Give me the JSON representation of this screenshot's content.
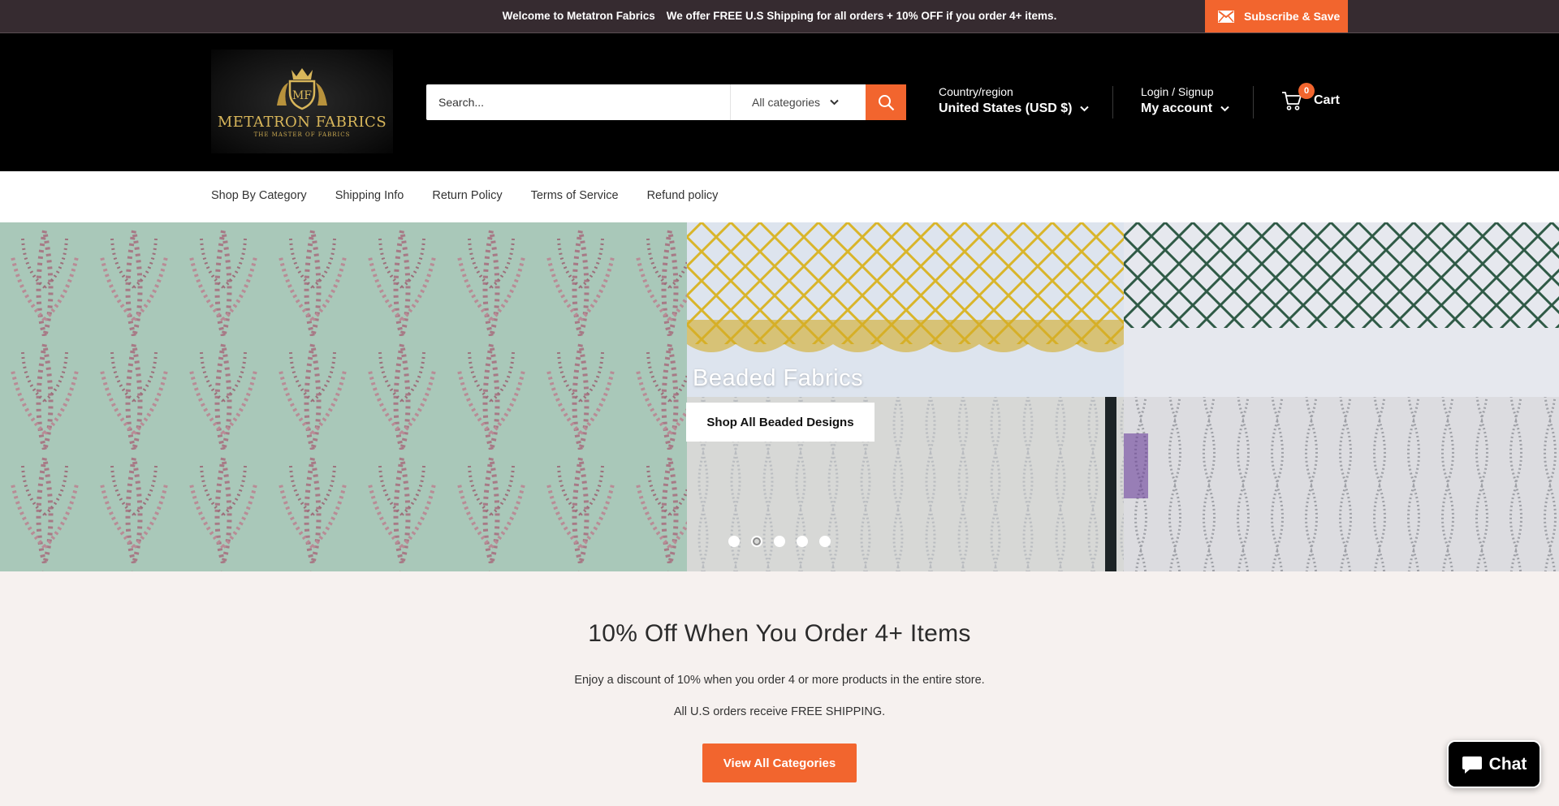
{
  "announcement": {
    "welcome": "Welcome to Metatron Fabrics",
    "offer": "We offer FREE U.S Shipping for all orders + 10% OFF if you order 4+ items.",
    "subscribe_label": "Subscribe & Save"
  },
  "header": {
    "logo_name": "METATRON FABRICS",
    "logo_tagline": "THE MASTER OF FABRICS",
    "search_placeholder": "Search...",
    "category_select": "All categories",
    "country_label": "Country/region",
    "country_value": "United States (USD $)",
    "account_label": "Login / Signup",
    "account_value": "My account",
    "cart_label": "Cart",
    "cart_count": "0"
  },
  "nav": {
    "items": [
      "Shop By Category",
      "Shipping Info",
      "Return Policy",
      "Terms of Service",
      "Refund policy"
    ]
  },
  "hero": {
    "title": "Beaded Fabrics",
    "button": "Shop All Beaded Designs",
    "slides": 5,
    "active_slide": 2
  },
  "promo": {
    "title": "10% Off When You Order 4+ Items",
    "line1": "Enjoy a discount of 10% when you order 4 or more products in the entire store.",
    "line2": "All U.S orders receive FREE SHIPPING.",
    "button": "View All Categories"
  },
  "chat": {
    "label": "Chat"
  },
  "colors": {
    "accent": "#f2652e",
    "announce_bg": "#362b30",
    "header_bg": "#000000",
    "page_bg": "#f6f1ef"
  }
}
